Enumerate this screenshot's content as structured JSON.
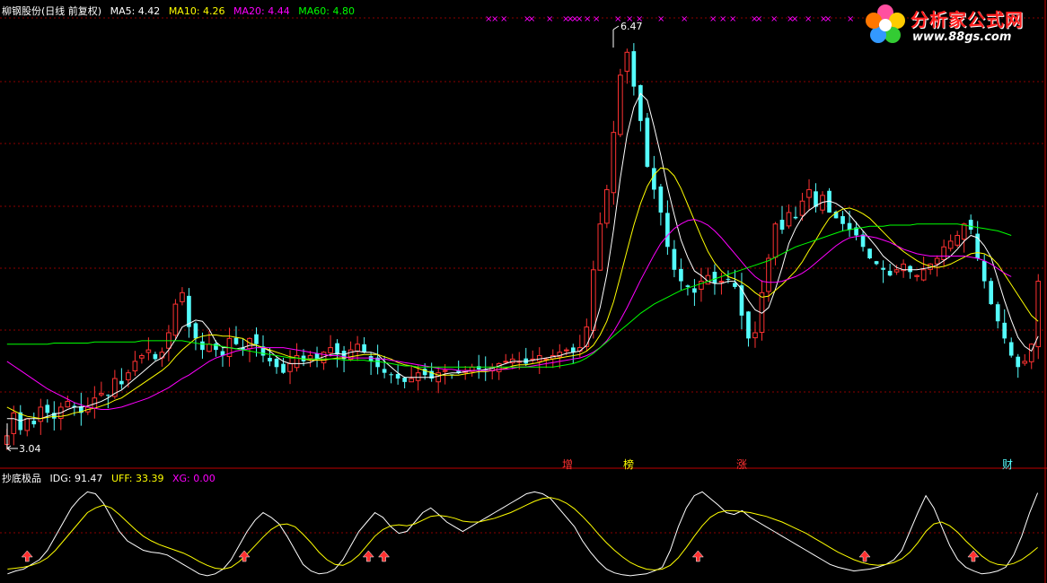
{
  "window": {
    "stock_name": "柳钢股份",
    "period": "(日线 前复权)"
  },
  "colors": {
    "bg": "#000000",
    "up": "#ff3232",
    "down": "#54fcfc",
    "ma5": "#ffffff",
    "ma10": "#ffff00",
    "ma20": "#ff00ff",
    "ma60": "#00ff00",
    "grid": "#8b0000",
    "idg": "#ffffff",
    "uff": "#ffff00",
    "xg": "#ff00ff"
  },
  "main_header": {
    "ma5": "MA5: 4.42",
    "ma10": "MA10: 4.26",
    "ma20": "MA20: 4.44",
    "ma60": "MA60: 4.80"
  },
  "indicator_header": {
    "name": "抄底极品",
    "idg": "IDG: 91.47",
    "uff": "UFF: 33.39",
    "xg": "XG: 0.00"
  },
  "events": [
    {
      "label": "增",
      "color": "#ff3232"
    },
    {
      "label": "榜",
      "color": "#ffff00"
    },
    {
      "label": "涨",
      "color": "#ff3232"
    },
    {
      "label": "财",
      "color": "#54fcfc"
    }
  ],
  "watermark": {
    "logo_text": "分析家公式网",
    "url": "www.88gs.com"
  },
  "markers": {
    "top_marks": "×"
  },
  "chart_data": [
    {
      "type": "candlestick",
      "title": "柳钢股份(日线 前复权)",
      "annotations": [
        {
          "label": "6.47",
          "kind": "high"
        },
        {
          "label": "3.04",
          "kind": "low"
        }
      ],
      "ylim": [
        2.9,
        6.7
      ],
      "close": [
        3.05,
        3.25,
        3.1,
        3.2,
        3.15,
        3.3,
        3.25,
        3.2,
        3.3,
        3.35,
        3.3,
        3.25,
        3.3,
        3.38,
        3.42,
        3.4,
        3.55,
        3.5,
        3.6,
        3.7,
        3.75,
        3.8,
        3.72,
        3.78,
        3.95,
        4.2,
        4.3,
        4.0,
        3.9,
        3.8,
        3.85,
        3.8,
        3.75,
        3.9,
        3.85,
        3.8,
        3.9,
        3.85,
        3.75,
        3.7,
        3.65,
        3.6,
        3.68,
        3.75,
        3.7,
        3.75,
        3.72,
        3.78,
        3.82,
        3.76,
        3.72,
        3.8,
        3.85,
        3.78,
        3.7,
        3.65,
        3.6,
        3.58,
        3.55,
        3.52,
        3.55,
        3.6,
        3.58,
        3.55,
        3.6,
        3.62,
        3.58,
        3.6,
        3.62,
        3.65,
        3.63,
        3.62,
        3.65,
        3.68,
        3.7,
        3.72,
        3.7,
        3.68,
        3.72,
        3.75,
        3.72,
        3.75,
        3.78,
        3.8,
        3.78,
        3.82,
        4.0,
        4.5,
        4.9,
        5.2,
        5.7,
        6.2,
        6.4,
        6.1,
        5.8,
        5.4,
        5.2,
        5.0,
        4.7,
        4.5,
        4.4,
        4.35,
        4.3,
        4.4,
        4.45,
        4.38,
        4.4,
        4.42,
        4.35,
        4.1,
        3.9,
        3.95,
        4.3,
        4.6,
        4.9,
        4.85,
        5.0,
        4.95,
        5.1,
        5.2,
        5.05,
        5.15,
        5.0,
        4.95,
        4.9,
        4.85,
        4.8,
        4.7,
        4.6,
        4.55,
        4.5,
        4.45,
        4.5,
        4.55,
        4.48,
        4.45,
        4.5,
        4.55,
        4.6,
        4.7,
        4.75,
        4.8,
        4.9,
        4.85,
        4.6,
        4.4,
        4.2,
        4.05,
        3.9,
        3.75,
        3.65,
        3.7,
        3.85,
        4.4
      ],
      "series": [
        {
          "name": "MA5",
          "values": [
            3.2,
            3.2,
            3.18,
            3.2,
            3.2,
            3.2,
            3.22,
            3.24,
            3.25,
            3.28,
            3.3,
            3.3,
            3.31,
            3.33,
            3.35,
            3.38,
            3.42,
            3.45,
            3.5,
            3.55,
            3.6,
            3.65,
            3.7,
            3.73,
            3.8,
            3.89,
            4.0,
            4.03,
            4.06,
            4.05,
            3.98,
            3.87,
            3.82,
            3.82,
            3.81,
            3.82,
            3.84,
            3.84,
            3.82,
            3.79,
            3.74,
            3.7,
            3.68,
            3.68,
            3.68,
            3.69,
            3.72,
            3.74,
            3.76,
            3.77,
            3.76,
            3.78,
            3.79,
            3.78,
            3.78,
            3.76,
            3.7,
            3.65,
            3.6,
            3.56,
            3.56,
            3.56,
            3.56,
            3.56,
            3.57,
            3.59,
            3.6,
            3.6,
            3.61,
            3.62,
            3.62,
            3.63,
            3.64,
            3.66,
            3.68,
            3.7,
            3.7,
            3.7,
            3.71,
            3.72,
            3.73,
            3.74,
            3.75,
            3.77,
            3.78,
            3.79,
            3.84,
            3.97,
            4.17,
            4.46,
            4.85,
            5.3,
            5.68,
            5.92,
            6.04,
            5.98,
            5.75,
            5.5,
            5.22,
            4.98,
            4.76,
            4.61,
            4.49,
            4.45,
            4.4,
            4.38,
            4.38,
            4.4,
            4.4,
            4.33,
            4.23,
            4.15,
            4.12,
            4.17,
            4.33,
            4.52,
            4.73,
            4.86,
            4.96,
            5.02,
            5.06,
            5.09,
            5.1,
            5.08,
            5.04,
            4.98,
            4.91,
            4.84,
            4.77,
            4.7,
            4.62,
            4.57,
            4.52,
            4.5,
            4.5,
            4.5,
            4.51,
            4.52,
            4.54,
            4.58,
            4.62,
            4.68,
            4.75,
            4.8,
            4.78,
            4.71,
            4.61,
            4.42,
            4.23,
            4.06,
            3.91,
            3.83,
            3.79,
            3.92
          ]
        },
        {
          "name": "MA10",
          "values": [
            3.3,
            3.27,
            3.24,
            3.22,
            3.21,
            3.2,
            3.21,
            3.22,
            3.22,
            3.23,
            3.25,
            3.26,
            3.28,
            3.29,
            3.31,
            3.33,
            3.36,
            3.38,
            3.42,
            3.46,
            3.5,
            3.54,
            3.58,
            3.62,
            3.67,
            3.74,
            3.8,
            3.85,
            3.9,
            3.92,
            3.93,
            3.93,
            3.92,
            3.92,
            3.91,
            3.9,
            3.86,
            3.84,
            3.82,
            3.8,
            3.78,
            3.76,
            3.74,
            3.73,
            3.72,
            3.71,
            3.71,
            3.71,
            3.72,
            3.73,
            3.73,
            3.74,
            3.75,
            3.76,
            3.76,
            3.76,
            3.74,
            3.72,
            3.69,
            3.67,
            3.66,
            3.64,
            3.62,
            3.6,
            3.58,
            3.58,
            3.58,
            3.58,
            3.59,
            3.6,
            3.61,
            3.61,
            3.62,
            3.63,
            3.64,
            3.66,
            3.67,
            3.67,
            3.68,
            3.69,
            3.71,
            3.72,
            3.73,
            3.74,
            3.75,
            3.76,
            3.79,
            3.84,
            3.93,
            4.05,
            4.22,
            4.44,
            4.67,
            4.89,
            5.08,
            5.23,
            5.33,
            5.39,
            5.38,
            5.32,
            5.21,
            5.07,
            4.93,
            4.79,
            4.66,
            4.56,
            4.49,
            4.44,
            4.42,
            4.39,
            4.35,
            4.3,
            4.26,
            4.27,
            4.32,
            4.37,
            4.43,
            4.49,
            4.57,
            4.67,
            4.76,
            4.86,
            4.95,
            5.0,
            5.03,
            5.04,
            5.02,
            4.99,
            4.95,
            4.89,
            4.83,
            4.77,
            4.71,
            4.66,
            4.62,
            4.58,
            4.55,
            4.53,
            4.52,
            4.53,
            4.55,
            4.58,
            4.61,
            4.64,
            4.65,
            4.64,
            4.61,
            4.55,
            4.46,
            4.37,
            4.28,
            4.19,
            4.1,
            4.05
          ]
        },
        {
          "name": "MA20",
          "values": [
            3.7,
            3.66,
            3.62,
            3.58,
            3.54,
            3.5,
            3.46,
            3.43,
            3.4,
            3.37,
            3.34,
            3.32,
            3.3,
            3.29,
            3.28,
            3.28,
            3.29,
            3.3,
            3.32,
            3.34,
            3.36,
            3.38,
            3.41,
            3.44,
            3.47,
            3.51,
            3.55,
            3.58,
            3.62,
            3.66,
            3.7,
            3.73,
            3.75,
            3.77,
            3.79,
            3.8,
            3.81,
            3.82,
            3.82,
            3.82,
            3.82,
            3.82,
            3.81,
            3.8,
            3.79,
            3.78,
            3.77,
            3.76,
            3.75,
            3.75,
            3.74,
            3.73,
            3.73,
            3.73,
            3.73,
            3.72,
            3.72,
            3.71,
            3.7,
            3.69,
            3.68,
            3.67,
            3.66,
            3.65,
            3.64,
            3.63,
            3.63,
            3.62,
            3.62,
            3.62,
            3.62,
            3.62,
            3.62,
            3.63,
            3.63,
            3.64,
            3.65,
            3.65,
            3.66,
            3.67,
            3.68,
            3.69,
            3.7,
            3.71,
            3.72,
            3.73,
            3.75,
            3.78,
            3.82,
            3.88,
            3.96,
            4.06,
            4.17,
            4.29,
            4.41,
            4.52,
            4.63,
            4.73,
            4.8,
            4.86,
            4.9,
            4.93,
            4.94,
            4.92,
            4.89,
            4.84,
            4.78,
            4.71,
            4.64,
            4.57,
            4.5,
            4.44,
            4.4,
            4.39,
            4.39,
            4.4,
            4.42,
            4.44,
            4.47,
            4.51,
            4.56,
            4.61,
            4.66,
            4.71,
            4.75,
            4.78,
            4.79,
            4.8,
            4.79,
            4.78,
            4.76,
            4.74,
            4.71,
            4.68,
            4.66,
            4.64,
            4.63,
            4.62,
            4.62,
            4.62,
            4.62,
            4.62,
            4.62,
            4.61,
            4.6,
            4.58,
            4.55,
            4.51,
            4.47,
            4.44
          ]
        },
        {
          "name": "MA60",
          "values": [
            3.85,
            3.85,
            3.85,
            3.85,
            3.85,
            3.85,
            3.85,
            3.86,
            3.86,
            3.86,
            3.86,
            3.86,
            3.86,
            3.87,
            3.87,
            3.87,
            3.87,
            3.87,
            3.87,
            3.87,
            3.88,
            3.88,
            3.88,
            3.88,
            3.88,
            3.88,
            3.88,
            3.87,
            3.86,
            3.85,
            3.85,
            3.84,
            3.83,
            3.82,
            3.81,
            3.8,
            3.79,
            3.78,
            3.77,
            3.76,
            3.75,
            3.74,
            3.73,
            3.73,
            3.72,
            3.72,
            3.72,
            3.72,
            3.72,
            3.72,
            3.71,
            3.71,
            3.71,
            3.71,
            3.7,
            3.7,
            3.69,
            3.68,
            3.67,
            3.66,
            3.66,
            3.65,
            3.65,
            3.65,
            3.65,
            3.65,
            3.65,
            3.65,
            3.65,
            3.65,
            3.65,
            3.65,
            3.65,
            3.65,
            3.65,
            3.65,
            3.65,
            3.65,
            3.65,
            3.65,
            3.65,
            3.65,
            3.66,
            3.67,
            3.68,
            3.7,
            3.73,
            3.77,
            3.82,
            3.87,
            3.92,
            3.97,
            4.02,
            4.07,
            4.12,
            4.16,
            4.2,
            4.23,
            4.26,
            4.29,
            4.32,
            4.34,
            4.36,
            4.38,
            4.4,
            4.42,
            4.44,
            4.46,
            4.48,
            4.5,
            4.52,
            4.54,
            4.56,
            4.58,
            4.61,
            4.64,
            4.67,
            4.7,
            4.72,
            4.74,
            4.76,
            4.78,
            4.8,
            4.82,
            4.84,
            4.85,
            4.86,
            4.87,
            4.88,
            4.88,
            4.88,
            4.89,
            4.89,
            4.89,
            4.89,
            4.9,
            4.9,
            4.9,
            4.9,
            4.9,
            4.9,
            4.9,
            4.89,
            4.88,
            4.87,
            4.86,
            4.85,
            4.84,
            4.82,
            4.8
          ]
        }
      ]
    },
    {
      "type": "line",
      "title": "抄底极品",
      "ylim": [
        0,
        100
      ],
      "series": [
        {
          "name": "IDG",
          "values": [
            5,
            8,
            10,
            15,
            20,
            30,
            45,
            60,
            75,
            85,
            92,
            90,
            80,
            65,
            50,
            40,
            35,
            30,
            28,
            27,
            25,
            20,
            15,
            10,
            5,
            3,
            5,
            10,
            20,
            35,
            50,
            62,
            70,
            65,
            58,
            45,
            30,
            15,
            8,
            5,
            6,
            10,
            20,
            35,
            50,
            60,
            70,
            65,
            55,
            48,
            50,
            60,
            70,
            75,
            68,
            60,
            55,
            50,
            55,
            60,
            65,
            70,
            75,
            80,
            85,
            90,
            92,
            90,
            85,
            75,
            65,
            55,
            40,
            28,
            18,
            10,
            6,
            4,
            3,
            4,
            5,
            8,
            12,
            30,
            55,
            75,
            88,
            92,
            85,
            78,
            70,
            68,
            72,
            65,
            60,
            55,
            50,
            45,
            40,
            35,
            30,
            25,
            20,
            15,
            12,
            10,
            8,
            9,
            10,
            12,
            15,
            20,
            30,
            50,
            70,
            88,
            75,
            55,
            35,
            20,
            12,
            8,
            5,
            6,
            8,
            12,
            25,
            45,
            70,
            91
          ]
        },
        {
          "name": "UFF",
          "values": [
            10,
            11,
            12,
            14,
            17,
            22,
            30,
            40,
            50,
            60,
            70,
            75,
            78,
            75,
            68,
            60,
            52,
            45,
            40,
            36,
            33,
            30,
            27,
            23,
            18,
            14,
            11,
            10,
            12,
            18,
            26,
            35,
            44,
            52,
            57,
            58,
            55,
            47,
            38,
            28,
            20,
            15,
            14,
            18,
            25,
            35,
            45,
            52,
            56,
            57,
            56,
            58,
            62,
            66,
            67,
            66,
            64,
            61,
            60,
            60,
            62,
            64,
            67,
            70,
            74,
            78,
            82,
            85,
            86,
            84,
            80,
            74,
            66,
            57,
            47,
            38,
            30,
            23,
            17,
            13,
            10,
            9,
            10,
            14,
            22,
            33,
            45,
            56,
            65,
            70,
            72,
            72,
            71,
            70,
            68,
            66,
            63,
            60,
            56,
            52,
            48,
            43,
            38,
            33,
            28,
            24,
            20,
            17,
            15,
            14,
            15,
            17,
            21,
            28,
            38,
            50,
            58,
            60,
            56,
            49,
            40,
            32,
            24,
            18,
            15,
            14,
            16,
            20,
            26,
            33
          ]
        }
      ]
    }
  ]
}
